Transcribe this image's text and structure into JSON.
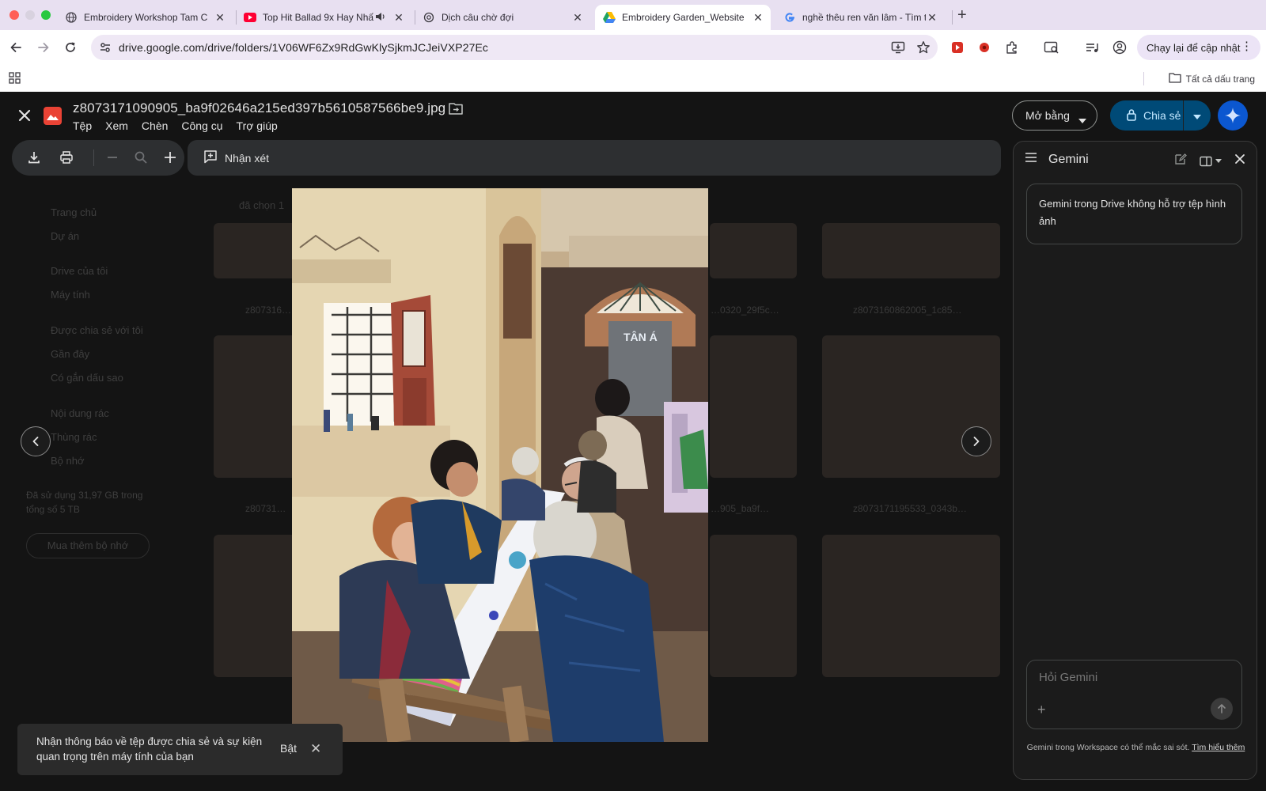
{
  "browser": {
    "tabs": [
      {
        "title": "Embroidery Workshop Tam C",
        "favicon": "globe-icon"
      },
      {
        "title": "Top Hit Ballad 9x Hay Nhấ",
        "favicon": "youtube-icon",
        "audio": true
      },
      {
        "title": "Dịch câu chờ đợi",
        "favicon": "openai-icon"
      },
      {
        "title": "Embroidery Garden_Website",
        "favicon": "google-drive-icon",
        "active": true
      },
      {
        "title": "nghề thêu ren văn lâm - Tìm t",
        "favicon": "google-icon"
      }
    ],
    "url": "drive.google.com/drive/folders/1V06WF6Zx9RdGwKlySjkmJCJeiVXP27Ec",
    "relaunch_label": "Chạy lại để cập nhật",
    "bookmarks_label": "Tất cả dấu trang"
  },
  "drive_background": {
    "sidebar": [
      "Trang chủ",
      "Dự án",
      "Drive của tôi",
      "Máy tính",
      "Được chia sẻ với tôi",
      "Gần đây",
      "Có gắn dấu sao",
      "Nội dung rác",
      "Thùng rác",
      "Bộ nhớ"
    ],
    "storage_text": "Đã sử dụng 31,97 GB trong tổng số 5 TB",
    "buy_storage": "Mua thêm bộ nhớ",
    "selected_text": "đã chọn 1",
    "file_labels": [
      "z807316…",
      "z80731…",
      "…0320_29f5c…",
      "z8073160862005_1c85…",
      "z80731…",
      "…905_ba9f…",
      "z8073171195533_0343b…"
    ]
  },
  "viewer": {
    "filename": "z8073171090905_ba9f02646a215ed397b5610587566be9.jpg",
    "menus": [
      "Tệp",
      "Xem",
      "Chèn",
      "Công cụ",
      "Trợ giúp"
    ],
    "open_with_label": "Mở bằng",
    "share_label": "Chia sẻ",
    "comment_label": "Nhận xét"
  },
  "photo": {
    "sign_text": "TÂN Á"
  },
  "gemini": {
    "title": "Gemini",
    "message": "Gemini trong Drive không hỗ trợ tệp hình ảnh",
    "input_placeholder": "Hỏi Gemini",
    "footer_text": "Gemini trong Workspace có thể mắc sai sót.",
    "footer_link": "Tìm hiểu thêm"
  },
  "notification": {
    "text": "Nhận thông báo về tệp được chia sẻ và sự kiện quan trọng trên máy tính của bạn",
    "enable_label": "Bật"
  },
  "colors": {
    "share_button_bg": "#004a77",
    "gemini_accent": "#0b57d0",
    "viewer_bg": "#1f1f1f",
    "tab_strip": "#e8e0f1"
  }
}
